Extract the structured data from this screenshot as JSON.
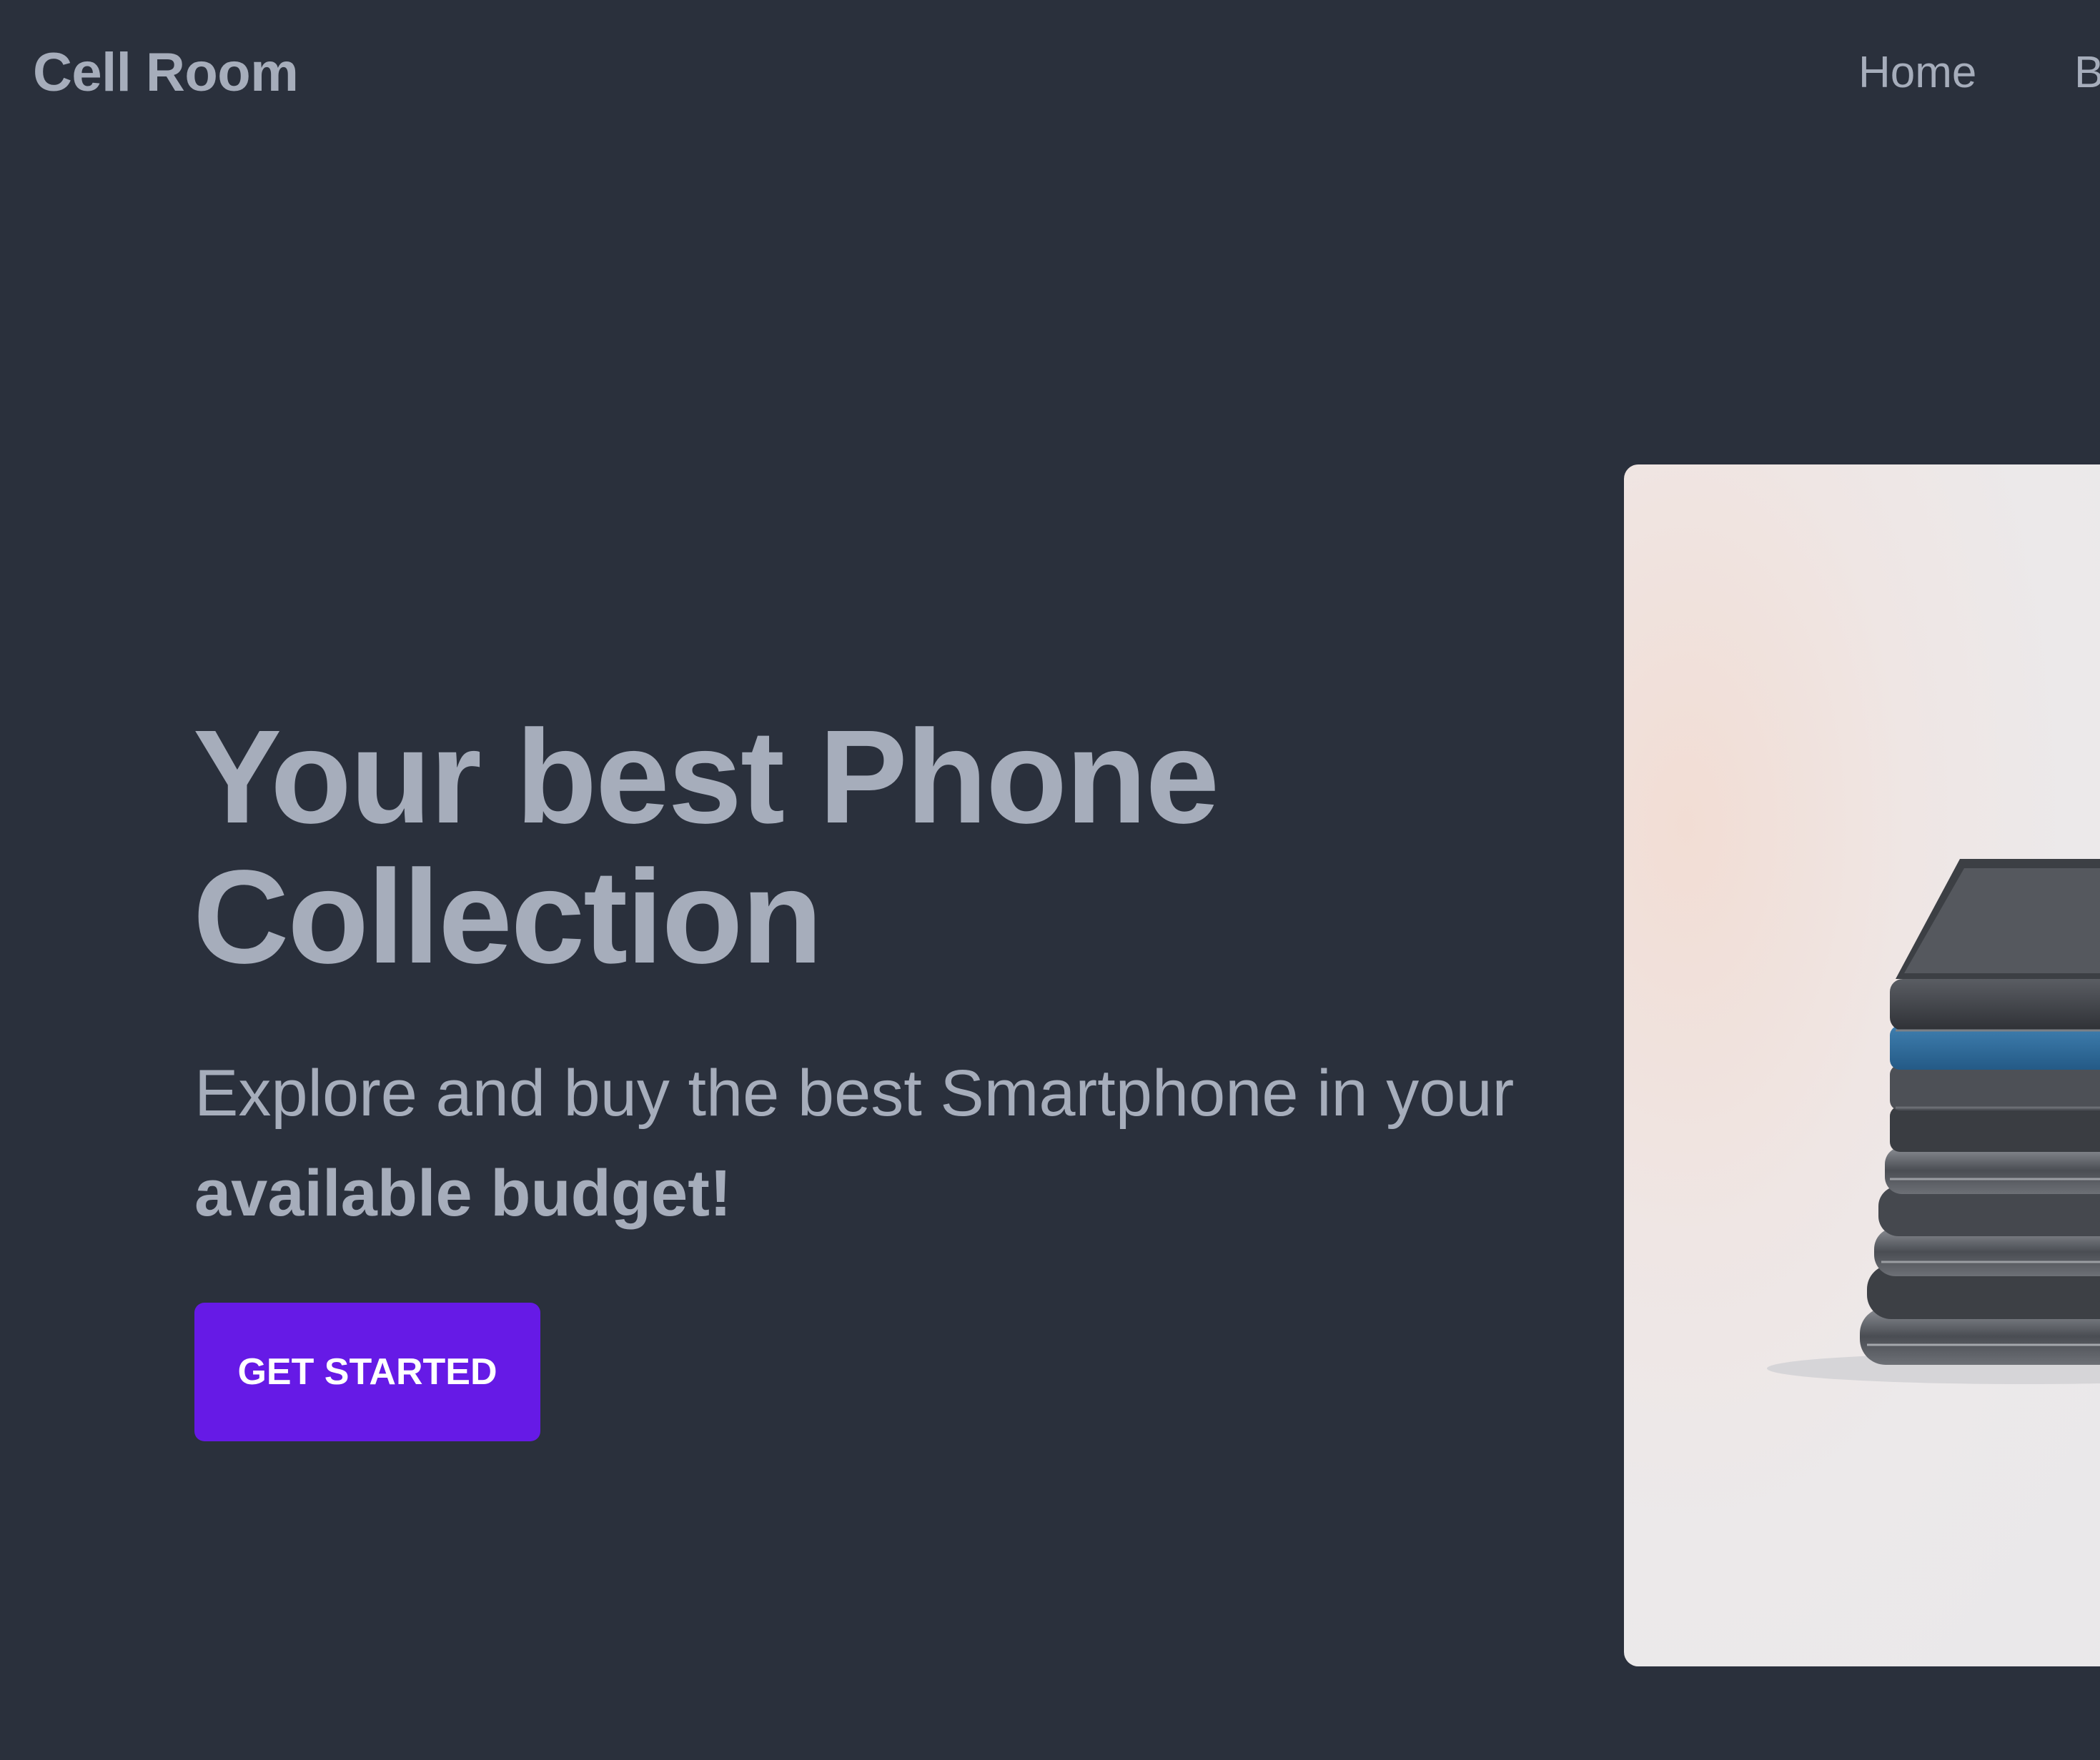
{
  "brand": "Cell Room",
  "nav": {
    "home": "Home",
    "next_partial": "B"
  },
  "hero": {
    "title_line1": "Your best Phone",
    "title_line2": "Collection",
    "subtitle_regular": "Explore and buy the best Smartphone in your",
    "subtitle_bold": "available budget!",
    "cta_label": "GET STARTED"
  },
  "colors": {
    "background": "#2a303c",
    "text": "#a6adbb",
    "cta": "#661ae6",
    "cta_text": "#ffffff"
  }
}
